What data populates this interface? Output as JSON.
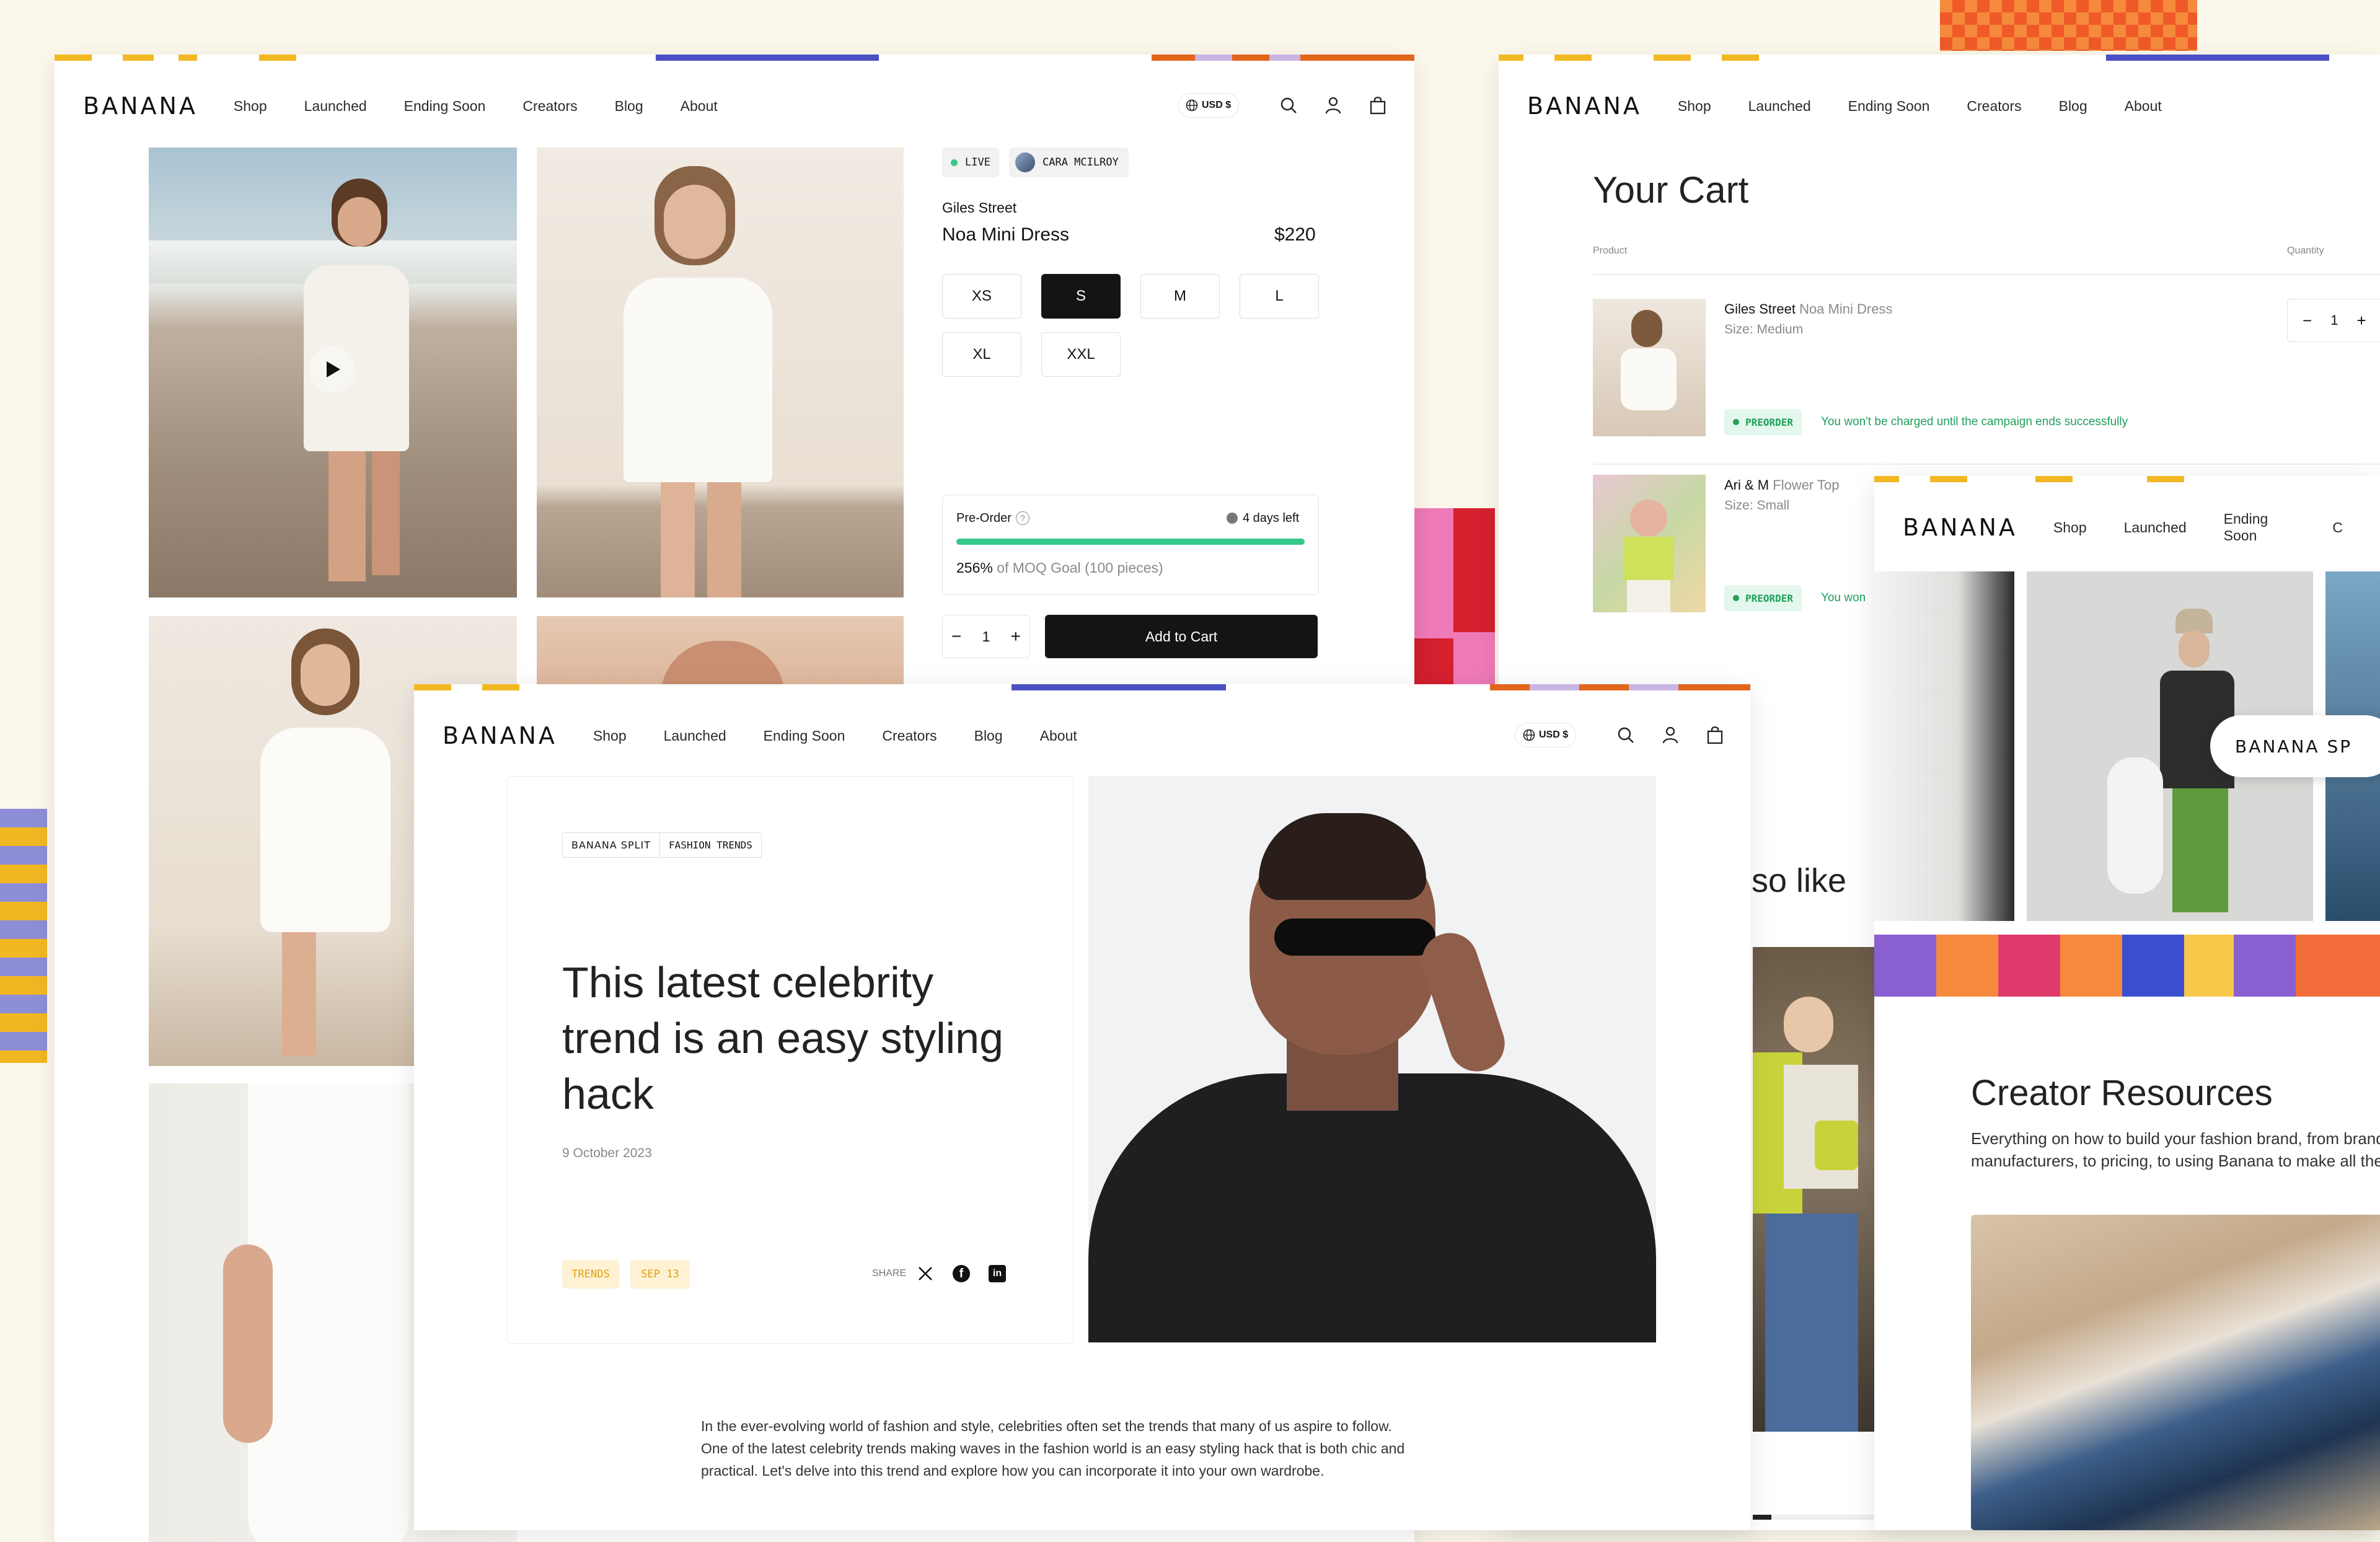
{
  "nav": {
    "logo": "BANANA",
    "links": [
      "Shop",
      "Launched",
      "Ending Soon",
      "Creators",
      "Blog",
      "About"
    ],
    "currency": "USD $"
  },
  "product_page": {
    "live_label": "LIVE",
    "creator_name": "CARA MCILROY",
    "brand": "Giles Street",
    "name": "Noa Mini Dress",
    "price": "$220",
    "sizes": [
      "XS",
      "S",
      "M",
      "L",
      "XL",
      "XXL"
    ],
    "selected_size": "S",
    "preorder_label": "Pre-Order",
    "days_left": "4 days left",
    "progress_fraction": 1.0,
    "moq_percent": "256%",
    "moq_text": "of MOQ Goal (100 pieces)",
    "quantity": "1",
    "add_to_cart": "Add to Cart"
  },
  "cart_page": {
    "title": "Your Cart",
    "col_product": "Product",
    "col_quantity": "Quantity",
    "items": [
      {
        "brand": "Giles Street",
        "name": "Noa Mini Dress",
        "size": "Size: Medium",
        "badge": "PREORDER",
        "note": "You won't be charged until the campaign ends successfully",
        "qty": "1"
      },
      {
        "brand": "Ari & M",
        "name": "Flower Top",
        "size": "Size: Small",
        "badge": "PREORDER",
        "note": "You won"
      }
    ],
    "also_like": "so like"
  },
  "creators_page": {
    "links": [
      "Shop",
      "Launched",
      "Ending Soon",
      "C"
    ],
    "floating_logo": "BANANA SP",
    "section_title": "Creator Resources",
    "section_text_1": "Everything on how to build your fashion brand, from brand",
    "section_text_2": "manufacturers, to pricing, to using Banana to make all the"
  },
  "blog_page": {
    "tag_brand": "BANANA SPLIT",
    "tag_category": "FASHION TRENDS",
    "title_line1": "This latest celebrity",
    "title_line2": "trend is an easy styling",
    "title_line3": "hack",
    "date": "9 October 2023",
    "chip1": "TRENDS",
    "chip2": "SEP 13",
    "share": "SHARE",
    "body_line1": "In the ever-evolving world of fashion and style, celebrities often set the trends that many of us aspire to follow.",
    "body_line2": "One of the latest celebrity trends making waves in the fashion world is an easy styling hack that is both chic and",
    "body_line3": "practical. Let's delve into this trend and explore how you can incorporate it into your own wardrobe."
  },
  "colors": {
    "accent_yellow": "#f2b822",
    "accent_orange": "#e2651a",
    "accent_blue": "#4a4fc4",
    "accent_lilac": "#c9b4e3",
    "preorder_green": "#1f9f5b",
    "progress_green": "#34c98a"
  }
}
